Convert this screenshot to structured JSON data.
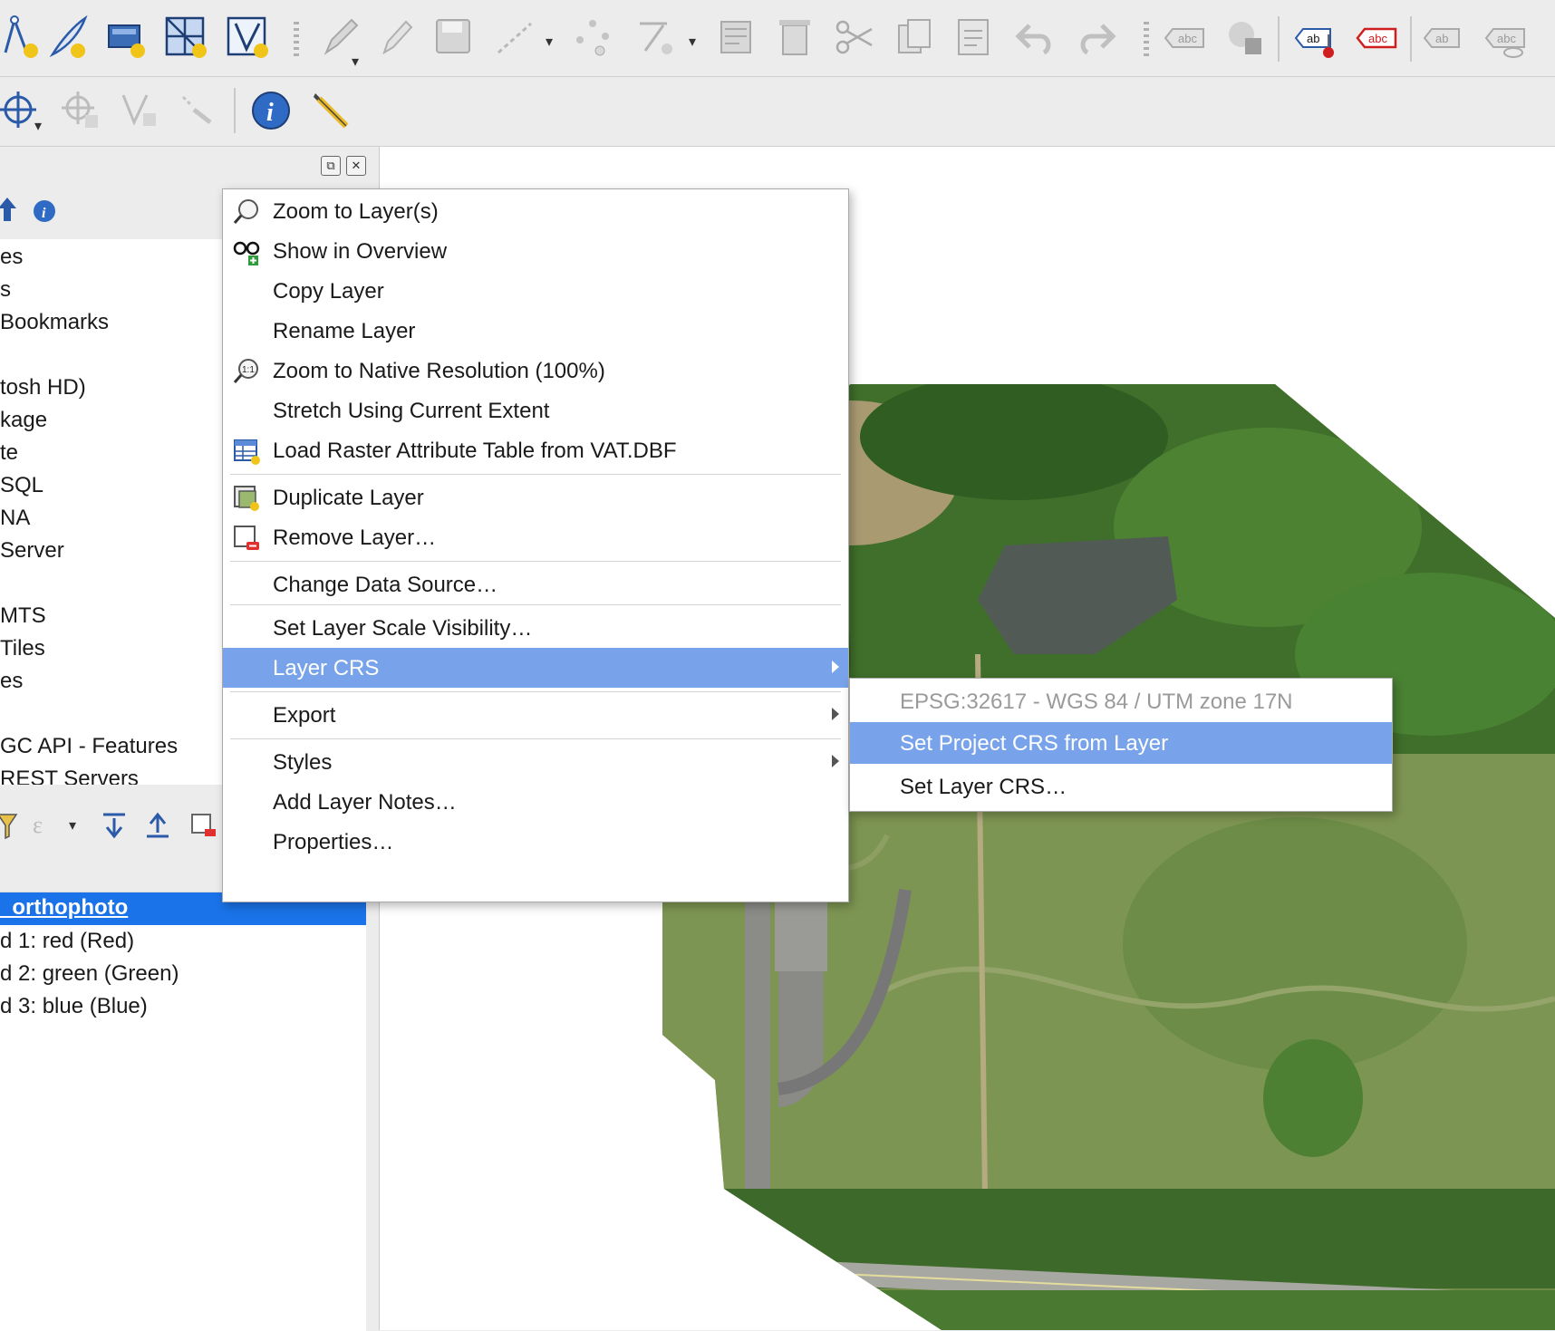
{
  "toolbar1": {
    "icons": [
      "digitize-vertex-icon",
      "new-shapefile-icon",
      "new-geopackage-icon",
      "new-gps-layer-icon",
      "new-mesh-icon",
      "new-virtual-layer-icon",
      "edit-pencil-icon",
      "toggle-editing-icon",
      "save-edits-icon",
      "digitize-line-icon",
      "vertex-tool-icon",
      "node-tool-icon",
      "modify-attributes-icon",
      "delete-selected-icon",
      "cut-features-icon",
      "copy-features-icon",
      "paste-features-icon",
      "undo-icon",
      "redo-icon",
      "label-abc-icon",
      "diagram-icon",
      "label-pin-icon",
      "label-abc-red-icon",
      "label-show-hide-icon",
      "label-view-icon"
    ]
  },
  "toolbar2": {
    "icons": [
      "pan-to-selection-icon",
      "add-ring-icon",
      "vertex-add-icon",
      "select-features-icon",
      "identify-info-icon",
      "settings-wrench-icon"
    ]
  },
  "browser_panel": {
    "items": [
      "es",
      "s",
      "Bookmarks",
      "tosh HD)",
      "kage",
      "te",
      "SQL",
      "NA",
      " Server",
      "MTS",
      "Tiles",
      "es",
      "GC API - Features",
      "REST Servers"
    ]
  },
  "layers_panel": {
    "selected_layer": "_orthophoto",
    "bands": [
      "d 1: red (Red)",
      "d 2: green (Green)",
      "d 3: blue (Blue)"
    ]
  },
  "context_menu": {
    "items": [
      {
        "label": "Zoom to Layer(s)",
        "icon": "zoom-layer-icon"
      },
      {
        "label": "Show in Overview",
        "icon": "overview-glasses-icon"
      },
      {
        "label": "Copy Layer",
        "icon": ""
      },
      {
        "label": "Rename Layer",
        "icon": ""
      },
      {
        "label": "Zoom to Native Resolution (100%)",
        "icon": "zoom-native-icon"
      },
      {
        "label": "Stretch Using Current Extent",
        "icon": ""
      },
      {
        "label": "Load Raster Attribute Table from VAT.DBF",
        "icon": "attribute-table-icon"
      },
      {
        "label": "Duplicate Layer",
        "icon": "duplicate-layer-icon"
      },
      {
        "label": "Remove Layer…",
        "icon": "remove-layer-icon"
      },
      {
        "label": "Change Data Source…",
        "icon": ""
      },
      {
        "label": "Set Layer Scale Visibility…",
        "icon": ""
      },
      {
        "label": "Layer CRS",
        "icon": ""
      },
      {
        "label": "Export",
        "icon": ""
      },
      {
        "label": "Styles",
        "icon": ""
      },
      {
        "label": "Add Layer Notes…",
        "icon": ""
      },
      {
        "label": "Properties…",
        "icon": ""
      }
    ],
    "highlighted": "Layer CRS"
  },
  "crs_submenu": {
    "current_crs": "EPSG:32617 - WGS 84 / UTM zone 17N",
    "set_project_crs": "Set Project CRS from Layer",
    "set_layer_crs": "Set Layer CRS…"
  },
  "colors": {
    "highlight": "#78a3ea",
    "selected_layer_bg": "#1a73e8",
    "toolbar_bg": "#ececec"
  }
}
